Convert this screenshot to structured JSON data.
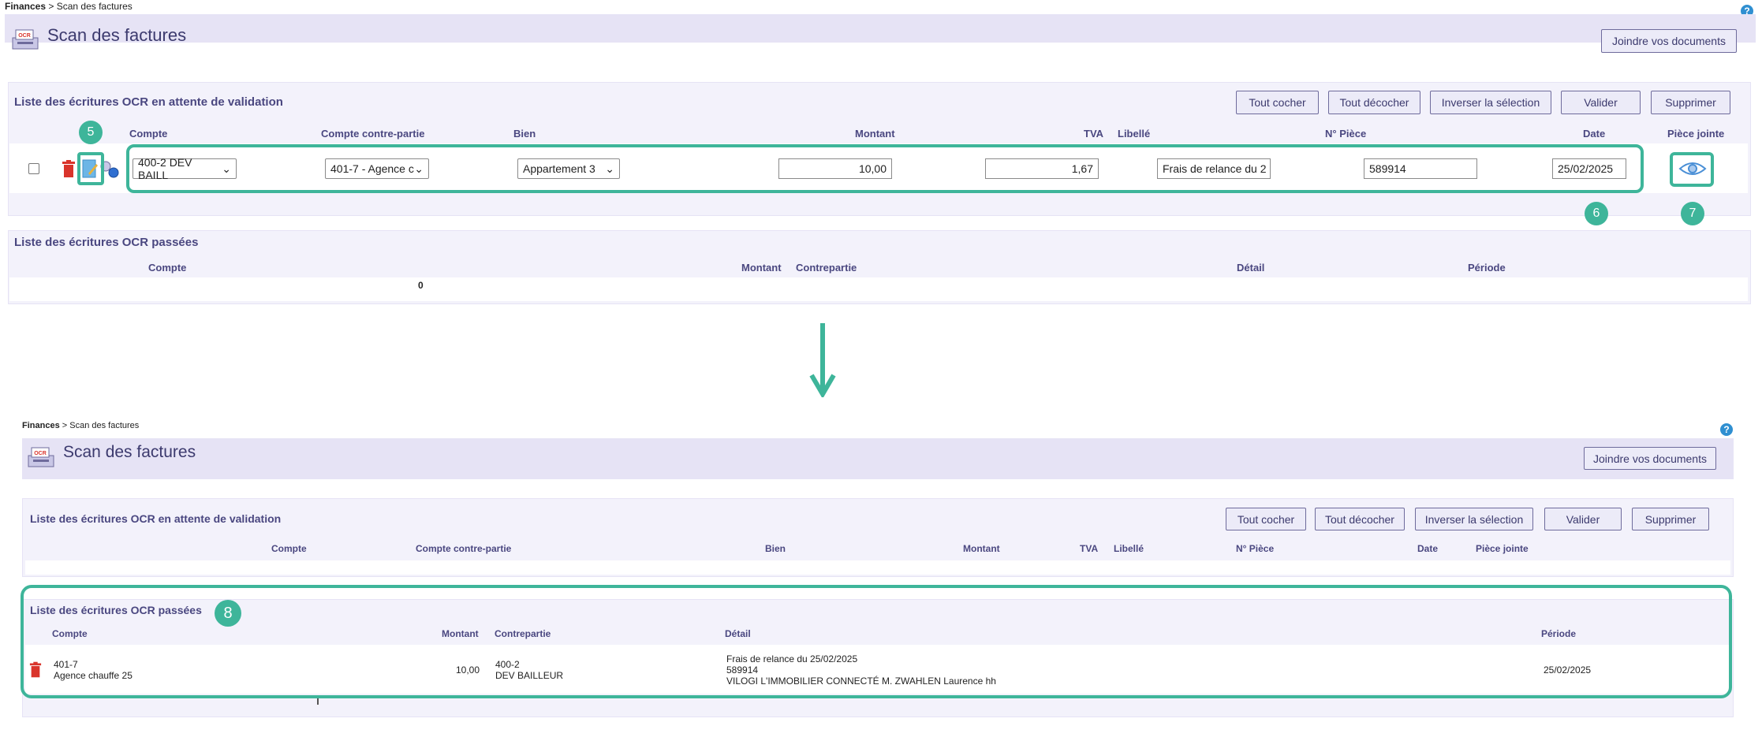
{
  "top": {
    "breadcrumb": {
      "root": "Finances",
      "sep": " > ",
      "current": "Scan des factures"
    },
    "title": "Scan des factures",
    "logo_text": "OCR",
    "join_button": "Joindre vos documents",
    "pending": {
      "title": "Liste des écritures OCR en attente de validation",
      "buttons": [
        "Tout cocher",
        "Tout décocher",
        "Inverser la sélection",
        "Valider",
        "Supprimer"
      ],
      "columns": [
        "Compte",
        "Compte contre-partie",
        "Bien",
        "Montant",
        "TVA",
        "Libellé",
        "N° Pièce",
        "Date",
        "Pièce jointe"
      ],
      "row": {
        "compte": "400-2 DEV BAILL",
        "contrepartie": "401-7 - Agence c",
        "bien": "Appartement 3",
        "montant": "10,00",
        "tva": "1,67",
        "libelle": "Frais de relance du 2",
        "piece": "589914",
        "date": "25/02/2025"
      }
    },
    "passed": {
      "title": "Liste des écritures OCR passées",
      "columns": [
        "Compte",
        "Montant",
        "Contrepartie",
        "Détail",
        "Période"
      ],
      "total": "0"
    },
    "badges": [
      "5",
      "6",
      "7"
    ]
  },
  "bottom": {
    "breadcrumb": {
      "root": "Finances",
      "sep": " > ",
      "current": "Scan des factures"
    },
    "title": "Scan des factures",
    "logo_text": "OCR",
    "join_button": "Joindre vos documents",
    "pending": {
      "title": "Liste des écritures OCR en attente de validation",
      "buttons": [
        "Tout cocher",
        "Tout décocher",
        "Inverser la sélection",
        "Valider",
        "Supprimer"
      ],
      "columns": [
        "Compte",
        "Compte contre-partie",
        "Bien",
        "Montant",
        "TVA",
        "Libellé",
        "N° Pièce",
        "Date",
        "Pièce jointe"
      ]
    },
    "passed": {
      "title": "Liste des écritures OCR passées",
      "columns": [
        "Compte",
        "Montant",
        "Contrepartie",
        "Détail",
        "Période"
      ],
      "row": {
        "compte_line1": "401-7",
        "compte_line2": "Agence chauffe 25",
        "montant": "10,00",
        "contrepartie_line1": "400-2",
        "contrepartie_line2": "DEV BAILLEUR",
        "detail_line1": "Frais de relance du 25/02/2025",
        "detail_line2": "589914",
        "detail_line3": "VILOGI L'IMMOBILIER CONNECTÉ M. ZWAHLEN Laurence hh",
        "periode": "25/02/2025"
      }
    },
    "badges": [
      "8"
    ]
  },
  "help_icon": "?",
  "colors": {
    "accent": "#3eb59a",
    "header_bg": "#e6e3f5",
    "title_color": "#3c3a6e",
    "help_blue": "#2f8fd1",
    "trash_red": "#d9342b"
  }
}
